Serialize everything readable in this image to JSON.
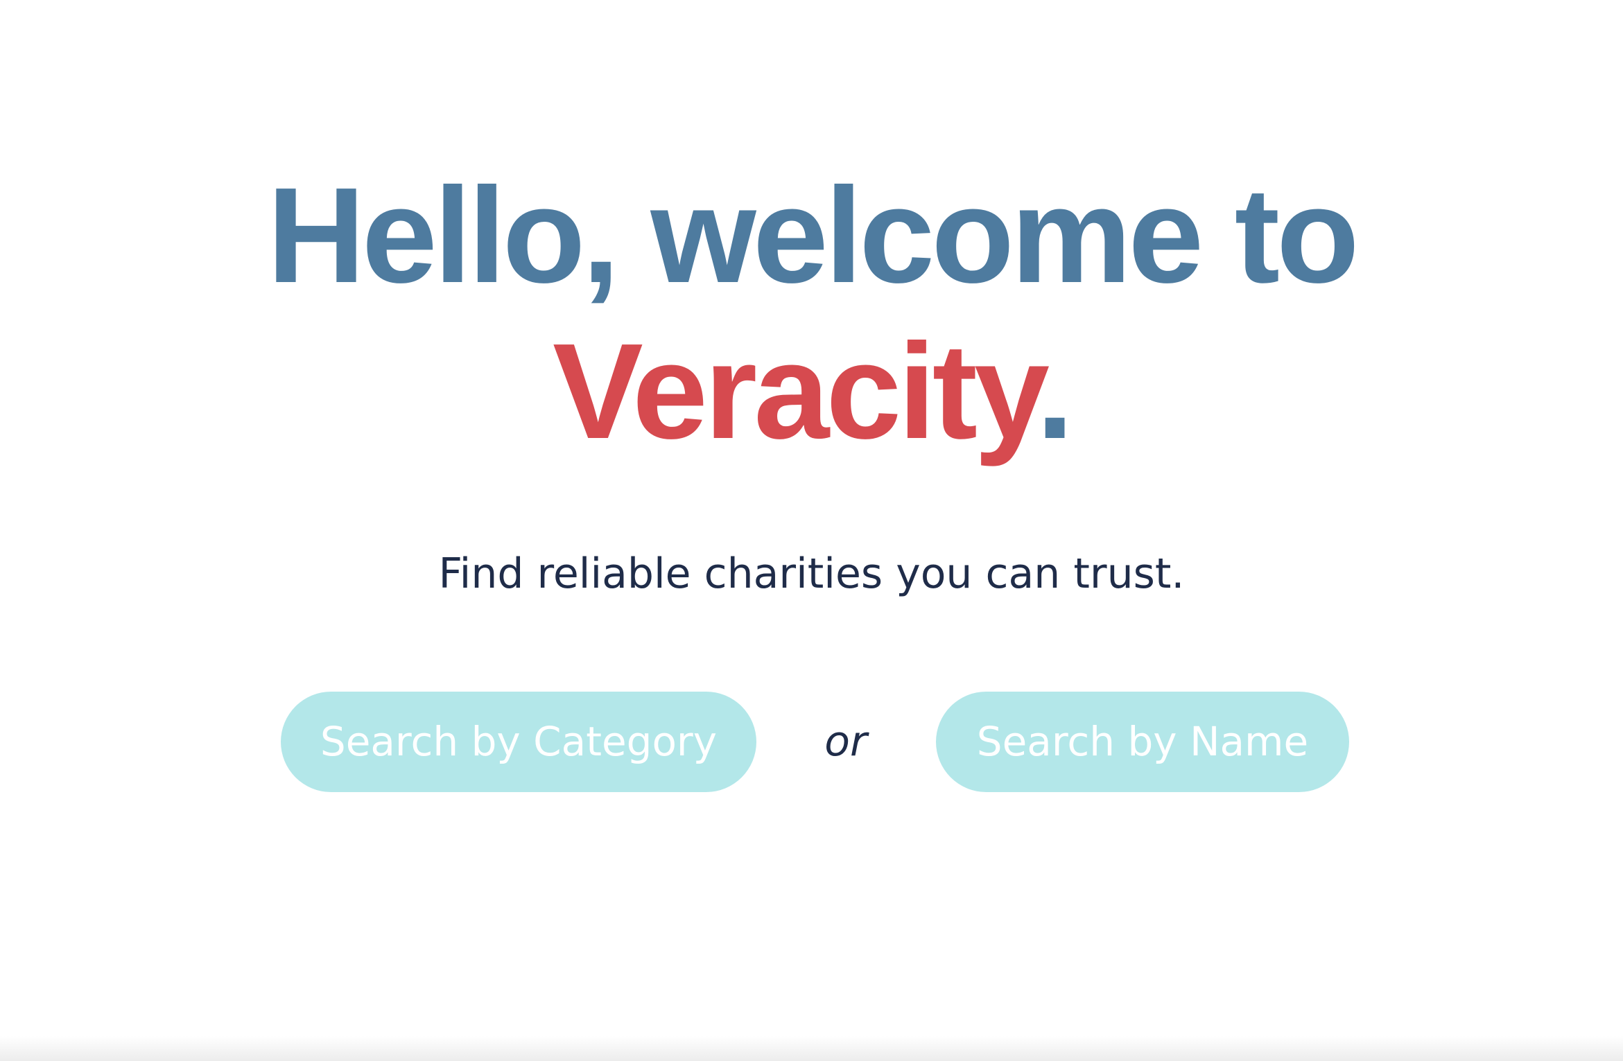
{
  "hero": {
    "line1": "Hello, welcome to",
    "line2_brand": "Veracity",
    "line2_period": ".",
    "subtitle": "Find reliable charities you can trust."
  },
  "search": {
    "category_label": "Search by Category",
    "separator": "or",
    "name_label": "Search by Name"
  },
  "colors": {
    "heading_blue": "#4e7b9f",
    "brand_red": "#d64a4f",
    "text_navy": "#1f2c49",
    "button_teal": "#b3e7e9",
    "button_text": "#ffffff",
    "background": "#ffffff"
  }
}
